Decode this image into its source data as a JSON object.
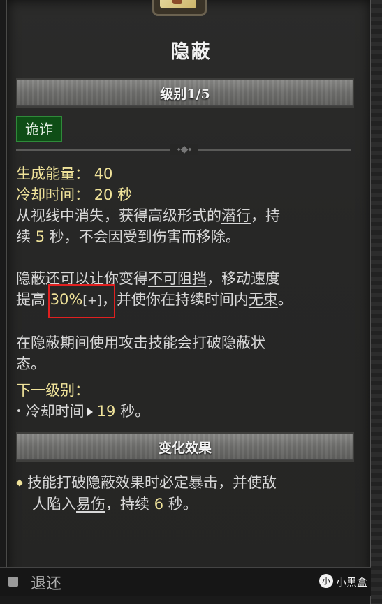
{
  "skill": {
    "title": "隐蔽",
    "level_label": "级别1/5",
    "category_tag": "诡诈",
    "energy_label": "生成能量：",
    "energy_value": "40",
    "cooldown_label": "冷却时间：",
    "cooldown_value": "20",
    "cooldown_unit": "秒",
    "desc1": {
      "a": "从视线中消失，获得高级形式的",
      "link": "潜行",
      "b": "，持",
      "c": "续",
      "dur": "5",
      "d": "秒，不会因受到伤害而移除。"
    },
    "desc2": {
      "a": "隐蔽还可以让你变得",
      "link1": "不可阻挡",
      "b": "，移动速度",
      "c": "提高",
      "pct": "30%",
      "plus": "[+]",
      "d": "，并使你在持续时间内",
      "link2": "无束",
      "e": "。"
    },
    "desc3": {
      "line1": "在隐蔽期间使用攻击技能会打破隐蔽状",
      "line2": "态。"
    },
    "next_level": {
      "header": "下一级别：",
      "item_label": "冷却时间",
      "item_value": "19",
      "item_unit": "秒。"
    },
    "modifier": {
      "header": "变化效果",
      "a": "技能打破隐蔽效果时必定暴击，并使敌",
      "b": "人陷入",
      "link": "易伤",
      "c": "，持续",
      "dur": "6",
      "d": "秒。"
    }
  },
  "footer": {
    "back_label": "退还",
    "watermark_logo": "小",
    "watermark_text": "小黑盒"
  },
  "colors": {
    "highlight": "#f0e39a",
    "tag_bg": "#0f4d16",
    "annotation_box": "#e02020"
  }
}
